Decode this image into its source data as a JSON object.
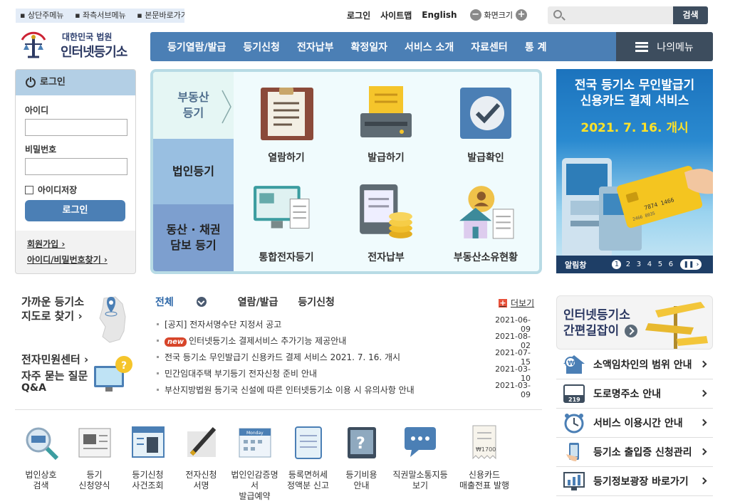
{
  "skip_links": [
    "상단주메뉴",
    "좌측서브메뉴",
    "본문바로가기"
  ],
  "util": {
    "login": "로그인",
    "sitemap": "사이트맵",
    "english": "English",
    "zoom": "화면크기",
    "zoom_minus": "−",
    "zoom_plus": "+"
  },
  "search": {
    "placeholder": "",
    "button": "검색"
  },
  "logo": {
    "line1": "대한민국 법원",
    "line2": "인터넷등기소"
  },
  "gnb": [
    "등기열람/발급",
    "등기신청",
    "전자납부",
    "확정일자",
    "서비스 소개",
    "자료센터",
    "통 계"
  ],
  "my_menu": "나의메뉴",
  "login": {
    "title": "로그인",
    "id_label": "아이디",
    "pw_label": "비밀번호",
    "save_id": "아이디저장",
    "button": "로그인",
    "join": "회원가입 ›",
    "find": "아이디/비밀번호찾기 ›"
  },
  "center": {
    "tabs": [
      "부동산 등기",
      "법인등기",
      "동산 · 채권 담보 등기"
    ],
    "tab1_l1": "부동산",
    "tab1_l2": "등기",
    "tab3_l1": "동산 · 채권",
    "tab3_l2": "담보 등기",
    "services": [
      "열람하기",
      "발급하기",
      "발급확인",
      "통합전자등기",
      "전자납부",
      "부동산소유현황"
    ]
  },
  "banner": {
    "line1": "전국 등기소 무인발급기",
    "line2": "신용카드 결제 서비스",
    "date": "2021. 7. 16. 개시",
    "label": "알림창",
    "pages": [
      "1",
      "2",
      "3",
      "4",
      "5",
      "6"
    ],
    "pause": "❚❚",
    "next": "›",
    "card_number": "7874 1466",
    "card_small": "2466 8035"
  },
  "near": {
    "t1": "가까운 등기소",
    "t2": "지도로 찾기 ›",
    "c1": "전자민원센터 ›",
    "c2": "자주 묻는 질문",
    "c3": "Q&A"
  },
  "notice": {
    "tabs": [
      "전체",
      "열람/발급",
      "등기신청"
    ],
    "more": "더보기",
    "items": [
      {
        "title": "[공지] 전자서명수단 지정서 공고",
        "date": "2021-06-09",
        "new": false
      },
      {
        "title": "인터넷등기소 결제서비스 추가기능 제공안내",
        "date": "2021-08-02",
        "new": true
      },
      {
        "title": "전국 등기소 무인발급기 신용카드 결제 서비스 2021. 7. 16. 개시",
        "date": "2021-07-15",
        "new": false
      },
      {
        "title": "민간임대주택 부기등기 전자신청 준비 안내",
        "date": "2021-03-10",
        "new": false
      },
      {
        "title": "부산지방법원 등기국 신설에 따른 인터넷등기소 이용 시 유의사항 안내",
        "date": "2021-03-09",
        "new": false
      }
    ],
    "new_badge": "new"
  },
  "quick": [
    {
      "l1": "법인상호",
      "l2": "검색"
    },
    {
      "l1": "등기",
      "l2": "신청양식"
    },
    {
      "l1": "등기신청",
      "l2": "사건조회"
    },
    {
      "l1": "전자신청",
      "l2": "서명"
    },
    {
      "l1": "법인인감증명서",
      "l2": "발급예약"
    },
    {
      "l1": "등록면허세",
      "l2": "정액분 신고"
    },
    {
      "l1": "등기비용",
      "l2": "안내"
    },
    {
      "l1": "직권말소통지등",
      "l2": "보기"
    },
    {
      "l1": "신용카드",
      "l2": "매출전표 발행"
    }
  ],
  "quick_small": {
    "monday": "Monday",
    "price": "₩1700"
  },
  "guide": {
    "l1": "인터넷등기소",
    "l2": "간편길잡이"
  },
  "right_links": [
    "소액임차인의 범위 안내",
    "도로명주소 안내",
    "서비스 이용시간 안내",
    "등기소 출입증 신청관리",
    "등기정보광장 바로가기"
  ],
  "right_small": {
    "road": "219"
  },
  "colors": {
    "accent": "#4b7fb5",
    "dark": "#3d4d5e",
    "banner_yellow": "#ffe227",
    "new": "#d7452a"
  }
}
